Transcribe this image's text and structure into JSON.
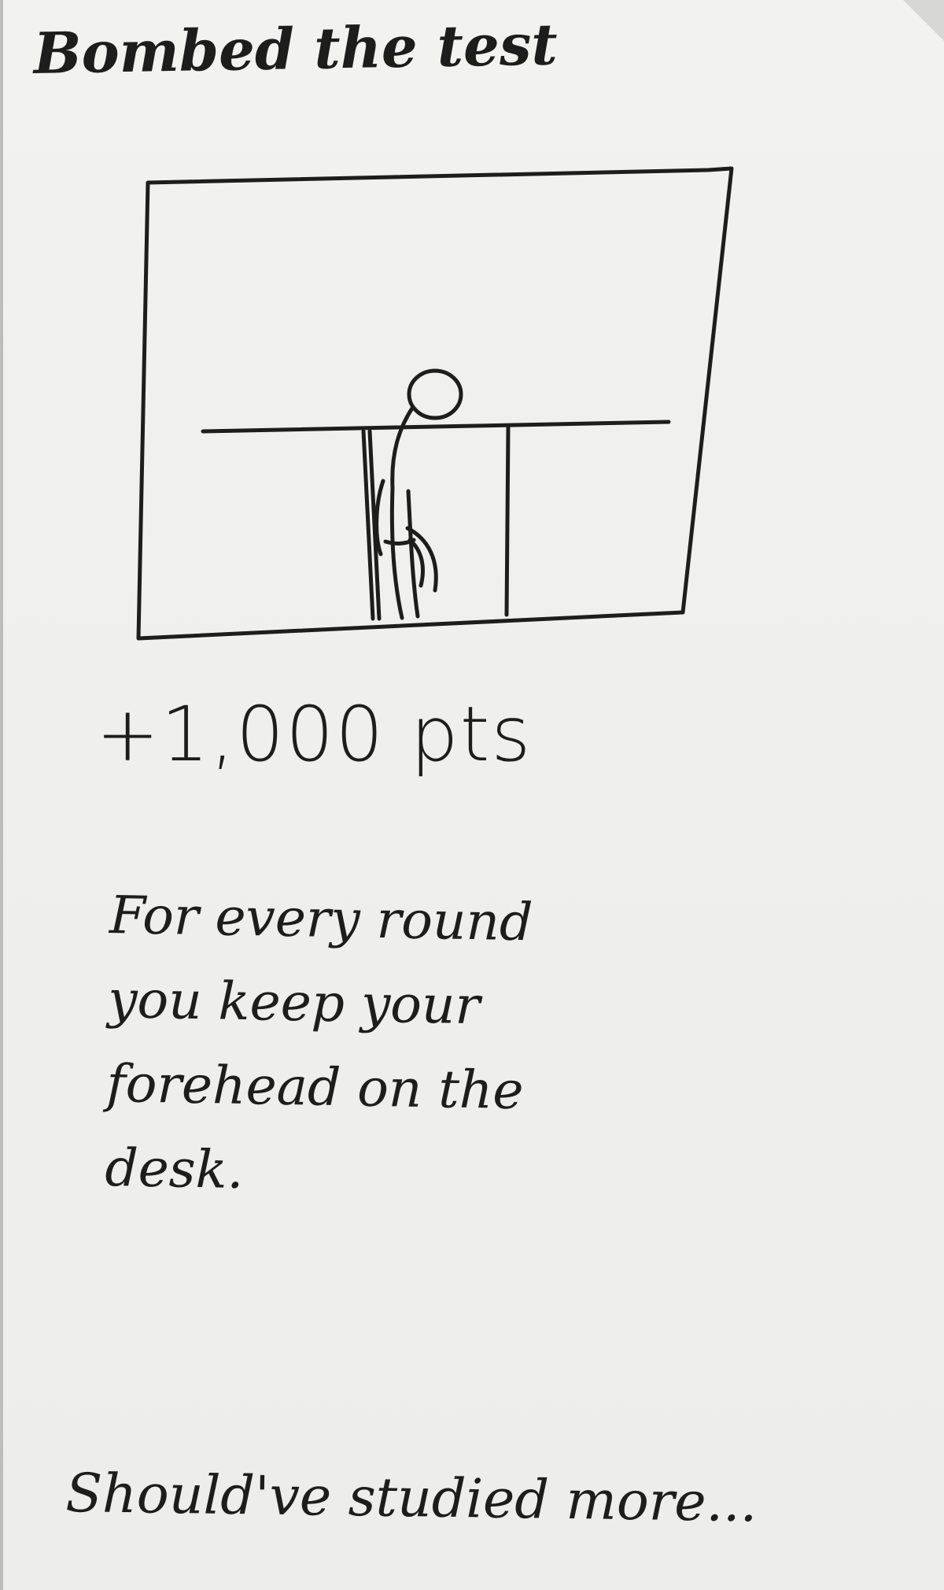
{
  "card": {
    "title": "Bombed the test",
    "points": "+1,000 pts",
    "description": "For every round\nyou keep your\nforehead on the\ndesk.",
    "footer": "Should've studied more..."
  },
  "colors": {
    "paper": "#f0f0ee",
    "ink": "#1d1d1d",
    "background": "#d7d7d5"
  }
}
